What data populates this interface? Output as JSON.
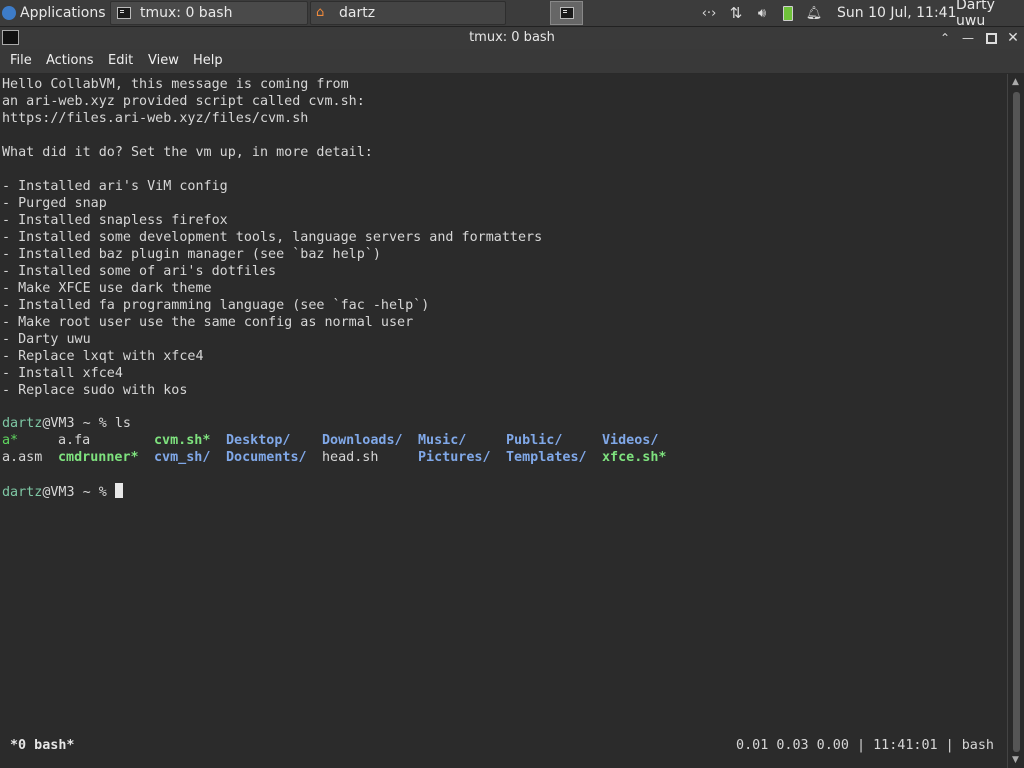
{
  "panel": {
    "applications_label": "Applications",
    "tasks": [
      {
        "label": "tmux: 0 bash"
      },
      {
        "label": "dartz"
      }
    ],
    "clock": "Sun 10 Jul, 11:41",
    "user": "Darty uwu"
  },
  "window": {
    "title": "tmux: 0 bash"
  },
  "menubar": {
    "file": "File",
    "actions": "Actions",
    "edit": "Edit",
    "view": "View",
    "help": "Help"
  },
  "terminal": {
    "lines": [
      "Hello CollabVM, this message is coming from",
      "an ari-web.xyz provided script called cvm.sh:",
      "https://files.ari-web.xyz/files/cvm.sh",
      "",
      "What did it do? Set the vm up, in more detail:",
      "",
      "- Installed ari's ViM config",
      "- Purged snap",
      "- Installed snapless firefox",
      "- Installed some development tools, language servers and formatters",
      "- Installed baz plugin manager (see `baz help`)",
      "- Installed some of ari's dotfiles",
      "- Make XFCE use dark theme",
      "- Installed fa programming language (see `fac -help`)",
      "- Make root user use the same config as normal user",
      "- Darty uwu",
      "- Replace lxqt with xfce4",
      "- Install xfce4",
      "- Replace sudo with kos"
    ],
    "prompt_user": "dartz",
    "prompt_rest": "@VM3 ~ % ",
    "command": "ls",
    "ls_row1": [
      {
        "text": "a*",
        "kind": "green"
      },
      {
        "text": "a.fa",
        "kind": "plain"
      },
      {
        "text": "cvm.sh*",
        "kind": "green-b"
      },
      {
        "text": "Desktop/",
        "kind": "blue"
      },
      {
        "text": "Downloads/",
        "kind": "blue"
      },
      {
        "text": "Music/",
        "kind": "blue"
      },
      {
        "text": "Public/",
        "kind": "blue"
      },
      {
        "text": "Videos/",
        "kind": "blue"
      }
    ],
    "ls_row2": [
      {
        "text": "a.asm",
        "kind": "plain"
      },
      {
        "text": "cmdrunner*",
        "kind": "green-b"
      },
      {
        "text": "cvm_sh/",
        "kind": "blue"
      },
      {
        "text": "Documents/",
        "kind": "blue"
      },
      {
        "text": "head.sh",
        "kind": "plain"
      },
      {
        "text": "Pictures/",
        "kind": "blue"
      },
      {
        "text": "Templates/",
        "kind": "blue"
      },
      {
        "text": "xfce.sh*",
        "kind": "green-b"
      }
    ]
  },
  "tmux_status": {
    "left": "*0 bash*",
    "right": "0.01 0.03 0.00 | 11:41:01 | bash"
  },
  "colors": {
    "background": "#2b2b2b",
    "executable": "#5fd75f",
    "directory": "#80a8e8"
  }
}
